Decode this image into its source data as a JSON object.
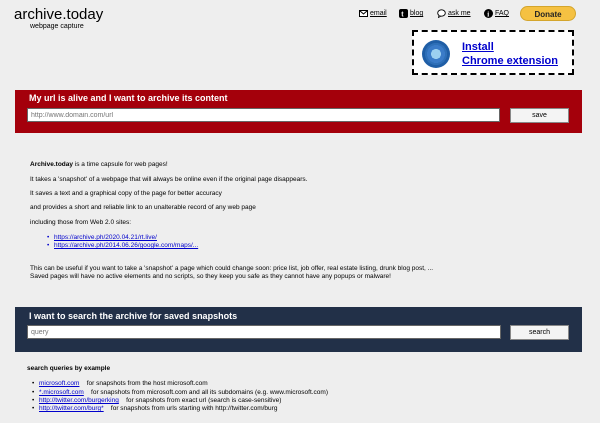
{
  "header": {
    "logo": "archive.today",
    "subtitle": "webpage capture",
    "links": [
      {
        "label": "email",
        "icon": "envelope-icon"
      },
      {
        "label": "blog",
        "icon": "tumblr-icon"
      },
      {
        "label": "ask me",
        "icon": "speech-bubble-icon"
      },
      {
        "label": "FAQ",
        "icon": "info-icon"
      }
    ],
    "donate_label": "Donate"
  },
  "extension": {
    "icon": "chrome-icon",
    "line1": "Install",
    "line2": "Chrome extension"
  },
  "archive_panel": {
    "title": "My url is alive and I want to archive its content",
    "input_placeholder": "http://www.domain.com/url",
    "button_label": "save",
    "color": "#a4000b"
  },
  "about": {
    "intro_bold": "Archive.today",
    "intro_rest": " is a time capsule for web pages!",
    "lines": [
      "It takes a 'snapshot' of a webpage that will always be online even if the original page disappears.",
      "It saves a text and a graphical copy of the page for better accuracy",
      "and provides a short and reliable link to an unalterable record of any web page",
      "including those from Web 2.0 sites:"
    ],
    "examples": [
      "https://archive.ph/2020.04.21/rt.live/",
      "https://archive.ph/2014.06.26/google.com/maps/..."
    ],
    "usage_line1": "This can be useful if you want to take a 'snapshot' a page which could change soon: price list, job offer, real estate listing, drunk blog post, ...",
    "usage_line2": "Saved pages will have no active elements and no scripts, so they keep you safe as they cannot have any popups or malware!"
  },
  "search_panel": {
    "title": "I want to search the archive for saved snapshots",
    "input_placeholder": "query",
    "button_label": "search",
    "color": "#223048"
  },
  "search_examples": {
    "heading": "search queries by example",
    "items": [
      {
        "query": "microsoft.com",
        "desc": "for snapshots from the host microsoft.com"
      },
      {
        "query": "*.microsoft.com",
        "desc": "for snapshots from microsoft.com and all its subdomains (e.g. www.microsoft.com)"
      },
      {
        "query": "http://twitter.com/burgerking",
        "desc": "for snapshots from exact url (search is case-sensitive)"
      },
      {
        "query": "http://twitter.com/burg*",
        "desc": "for snapshots from urls starting with http://twitter.com/burg"
      }
    ]
  }
}
